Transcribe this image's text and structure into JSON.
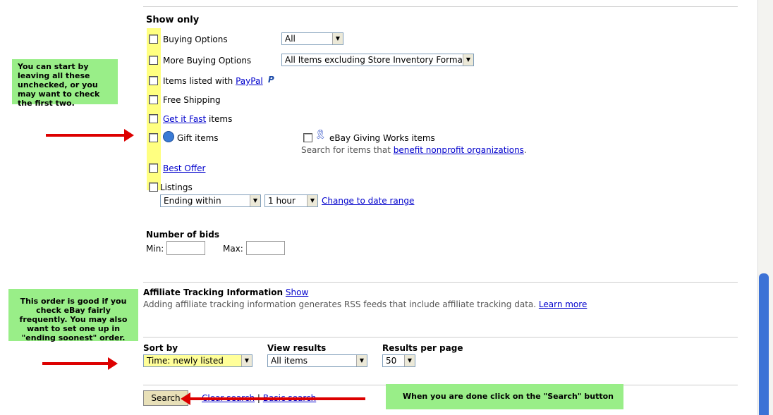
{
  "show_only": {
    "heading": "Show only",
    "buying_options": {
      "label": "Buying Options",
      "value": "All"
    },
    "more_buying_options": {
      "label": "More Buying Options",
      "value": "All Items excluding Store Inventory Format"
    },
    "paypal": {
      "prefix": "Items listed with",
      "link": "PayPal"
    },
    "free_shipping": {
      "label": "Free Shipping"
    },
    "get_it_fast": {
      "link": "Get it Fast",
      "suffix": "items"
    },
    "gift": {
      "label": "Gift items"
    },
    "giving_works": {
      "label": "eBay Giving Works items",
      "desc": "Search for items that",
      "link": "benefit nonprofit organizations"
    },
    "best_offer": {
      "link": "Best Offer"
    },
    "listings": {
      "label": "Listings",
      "ending_value": "Ending within",
      "time_value": "1 hour",
      "date_range_link": "Change to date range"
    }
  },
  "bids": {
    "heading": "Number of bids",
    "min_label": "Min:",
    "max_label": "Max:",
    "min_value": "",
    "max_value": ""
  },
  "affiliate": {
    "heading": "Affiliate Tracking Information",
    "show_link": "Show",
    "desc": "Adding affiliate tracking information generates RSS feeds that include affiliate tracking data.",
    "learn_more": "Learn more"
  },
  "sort": {
    "label": "Sort by",
    "value": "Time: newly listed"
  },
  "view": {
    "label": "View results",
    "value": "All items"
  },
  "per_page": {
    "label": "Results per page",
    "value": "50"
  },
  "actions": {
    "search": "Search",
    "clear": "Clear search",
    "sep": "|",
    "basic": "Basic search"
  },
  "callouts": {
    "first": "You can start by leaving all these unchecked, or you may want to check the first two.",
    "second": "This order is good if you check eBay fairly frequently.  You may also want to set one up in \"ending soonest\" order.",
    "third": "When you are done click on the \"Search\" button"
  },
  "colors": {
    "highlight": "#ffff80",
    "callout": "#99ee88",
    "arrow": "#dd0000",
    "link": "#0000cc"
  }
}
